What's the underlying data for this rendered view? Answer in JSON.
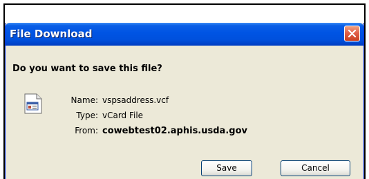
{
  "dialog": {
    "title": "File Download",
    "question": "Do you want to save this file?",
    "file": {
      "icon": "vcard-file-icon",
      "name_label": "Name:",
      "name_value": "vspsaddress.vcf",
      "type_label": "Type:",
      "type_value": "vCard File",
      "from_label": "From:",
      "from_value": "cowebtest02.aphis.usda.gov"
    },
    "buttons": {
      "save": "Save",
      "cancel": "Cancel"
    },
    "close_icon": "close-icon"
  },
  "colors": {
    "titlebar": "#0054e3",
    "dialog_bg": "#ece9d8",
    "close_button": "#e2614a",
    "frame_border": "#000000"
  }
}
